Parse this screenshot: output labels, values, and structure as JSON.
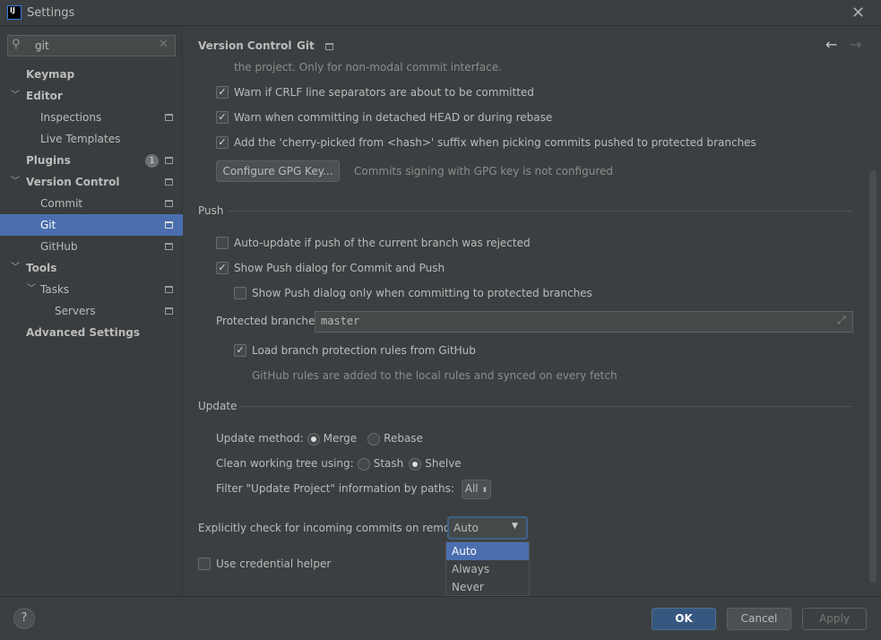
{
  "window": {
    "title": "Settings",
    "logo": "IJ"
  },
  "search": {
    "value": "git",
    "icon": "search-icon"
  },
  "sidebar": {
    "items": [
      {
        "label": "Keymap"
      },
      {
        "label": "Editor"
      },
      {
        "label": "Inspections"
      },
      {
        "label": "Live Templates"
      },
      {
        "label": "Plugins",
        "badge": "1"
      },
      {
        "label": "Version Control"
      },
      {
        "label": "Commit"
      },
      {
        "label": "Git"
      },
      {
        "label": "GitHub"
      },
      {
        "label": "Tools"
      },
      {
        "label": "Tasks"
      },
      {
        "label": "Servers"
      },
      {
        "label": "Advanced Settings"
      }
    ]
  },
  "breadcrumb": {
    "parent": "Version Control",
    "sep": "›",
    "current": "Git"
  },
  "commit": {
    "truncated": "the project. Only for non-modal commit interface.",
    "warn_crlf": "Warn if CRLF line separators are about to be committed",
    "warn_detached": "Warn when committing in detached HEAD or during rebase",
    "cherry_pick": "Add the 'cherry-picked from <hash>' suffix when picking commits pushed to protected branches",
    "gpg_button": "Configure GPG Key...",
    "gpg_status": "Commits signing with GPG key is not configured"
  },
  "push": {
    "title": "Push",
    "auto_update": "Auto-update if push of the current branch was rejected",
    "show_dialog": "Show Push dialog for Commit and Push",
    "show_dialog_protected": "Show Push dialog only when committing to protected branches",
    "protected_label": "Protected branches:",
    "protected_value": "master",
    "load_rules": "Load branch protection rules from GitHub",
    "rules_hint": "GitHub rules are added to the local rules and synced on every fetch"
  },
  "update": {
    "title": "Update",
    "method_label": "Update method:",
    "merge": "Merge",
    "rebase": "Rebase",
    "clean_label": "Clean working tree using:",
    "stash": "Stash",
    "shelve": "Shelve",
    "filter_label": "Filter \"Update Project\" information by paths:",
    "filter_value": "All"
  },
  "incoming": {
    "label": "Explicitly check for incoming commits on remotes:",
    "value": "Auto",
    "options": [
      "Auto",
      "Always",
      "Never"
    ]
  },
  "credential": "Use credential helper",
  "footer": {
    "help": "?",
    "ok": "OK",
    "cancel": "Cancel",
    "apply": "Apply"
  },
  "colors": {
    "accent": "#4b6eaf",
    "bg": "#3c3f41"
  }
}
